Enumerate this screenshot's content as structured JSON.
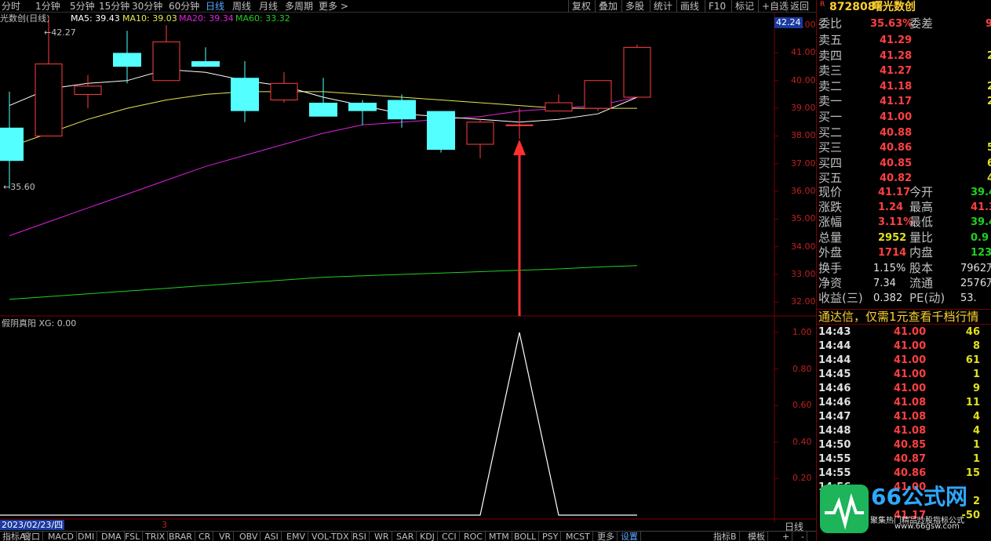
{
  "toolbar": {
    "periods": [
      "分时",
      "1分钟",
      "5分钟",
      "15分钟",
      "30分钟",
      "60分钟",
      "日线",
      "周线",
      "月线",
      "多周期",
      "更多 >"
    ],
    "active_period": "日线",
    "right_buttons": [
      "复权",
      "叠加",
      "多股",
      "统计",
      "画线",
      "F10",
      "标记",
      "+自选",
      "返回"
    ]
  },
  "legend": {
    "title": "光数创(日线)",
    "ma5": "MA5: 39.43",
    "ma10": "MA10: 39.03",
    "ma20": "MA20: 39.34",
    "ma60": "MA60: 33.32"
  },
  "colors": {
    "up": "#ff4040",
    "down": "#54ffff",
    "ma5": "#ffffff",
    "ma10": "#e8e850",
    "ma20": "#e020e0",
    "ma60": "#20d020",
    "grid": "#7a0000",
    "arrow": "#ff3030"
  },
  "main_chart": {
    "price_axis": [
      "42.00",
      "41.00",
      "40.00",
      "39.00",
      "38.00",
      "37.00",
      "36.00",
      "35.00",
      "34.00",
      "33.00",
      "32.00"
    ],
    "current_price_label": "42.24",
    "high_marker": "42.27",
    "low_marker": "35.60"
  },
  "indicator": {
    "title": "假阴真阳 XG: 0.00",
    "axis": [
      "1.00",
      "0.80",
      "0.60",
      "0.40",
      "0.20"
    ],
    "period_label": "日线"
  },
  "chart_data": {
    "type": "candlestick",
    "ohlc": [
      {
        "o": 38.3,
        "h": 39.6,
        "l": 36.1,
        "c": 37.1
      },
      {
        "o": 38.0,
        "h": 42.27,
        "l": 38.0,
        "c": 40.6
      },
      {
        "o": 39.5,
        "h": 40.2,
        "l": 39.0,
        "c": 39.8
      },
      {
        "o": 41.0,
        "h": 41.8,
        "l": 39.9,
        "c": 40.5
      },
      {
        "o": 40.0,
        "h": 42.0,
        "l": 40.0,
        "c": 41.4
      },
      {
        "o": 40.7,
        "h": 41.2,
        "l": 40.5,
        "c": 40.5
      },
      {
        "o": 40.1,
        "h": 40.7,
        "l": 38.5,
        "c": 38.9
      },
      {
        "o": 39.3,
        "h": 40.3,
        "l": 39.2,
        "c": 39.9
      },
      {
        "o": 39.2,
        "h": 40.1,
        "l": 38.8,
        "c": 38.7
      },
      {
        "o": 39.2,
        "h": 39.3,
        "l": 38.4,
        "c": 38.9
      },
      {
        "o": 39.3,
        "h": 39.5,
        "l": 38.3,
        "c": 38.6
      },
      {
        "o": 38.9,
        "h": 38.9,
        "l": 37.4,
        "c": 37.5
      },
      {
        "o": 37.7,
        "h": 38.6,
        "l": 37.2,
        "c": 38.5
      },
      {
        "o": 38.4,
        "h": 39.0,
        "l": 37.9,
        "c": 38.4
      },
      {
        "o": 38.9,
        "h": 39.5,
        "l": 38.9,
        "c": 39.2
      },
      {
        "o": 39.0,
        "h": 40.0,
        "l": 38.9,
        "c": 40.0
      },
      {
        "o": 39.4,
        "h": 41.3,
        "l": 39.4,
        "c": 41.2
      }
    ],
    "ma5": [
      39.1,
      39.7,
      39.9,
      40.0,
      40.4,
      40.3,
      40.0,
      39.8,
      39.4,
      39.1,
      38.8,
      38.7,
      38.6,
      38.5,
      38.6,
      38.8,
      39.4
    ],
    "ma10": [
      37.6,
      38.1,
      38.6,
      39.0,
      39.3,
      39.5,
      39.6,
      39.6,
      39.6,
      39.5,
      39.4,
      39.3,
      39.2,
      39.1,
      39.0,
      39.0,
      39.0
    ],
    "ma20": [
      34.4,
      34.9,
      35.4,
      35.9,
      36.4,
      36.9,
      37.3,
      37.7,
      38.1,
      38.4,
      38.5,
      38.6,
      38.7,
      38.9,
      39.0,
      39.1,
      39.4
    ],
    "ma60": [
      32.1,
      32.2,
      32.3,
      32.4,
      32.5,
      32.6,
      32.7,
      32.8,
      32.9,
      32.95,
      33.0,
      33.05,
      33.1,
      33.15,
      33.2,
      33.27,
      33.32
    ],
    "signal": [
      0,
      0,
      0,
      0,
      0,
      0,
      0,
      0,
      0,
      0,
      0,
      0,
      0,
      1,
      0,
      0,
      0
    ],
    "ylim": [
      31.5,
      42.4
    ]
  },
  "right_panel": {
    "code": "872808",
    "name": "曙光数创",
    "r_badge": "R",
    "weibi_label": "委比",
    "weibi": "35.63%",
    "weicha_label": "委差",
    "weicha": "9",
    "asks": [
      {
        "label": "卖五",
        "price": "41.29",
        "vol": ""
      },
      {
        "label": "卖四",
        "price": "41.28",
        "vol": "2"
      },
      {
        "label": "卖三",
        "price": "41.27",
        "vol": ""
      },
      {
        "label": "卖二",
        "price": "41.18",
        "vol": "2"
      },
      {
        "label": "卖一",
        "price": "41.17",
        "vol": "2"
      }
    ],
    "bids": [
      {
        "label": "买一",
        "price": "41.00",
        "vol": ""
      },
      {
        "label": "买二",
        "price": "40.88",
        "vol": ""
      },
      {
        "label": "买三",
        "price": "40.86",
        "vol": "5"
      },
      {
        "label": "买四",
        "price": "40.85",
        "vol": "6"
      },
      {
        "label": "买五",
        "price": "40.82",
        "vol": "4"
      }
    ],
    "stats": [
      {
        "l1": "现价",
        "v1": "41.17",
        "l2": "今开",
        "v2": "39.4",
        "c1": "red",
        "c2": "green"
      },
      {
        "l1": "涨跌",
        "v1": "1.24",
        "l2": "最高",
        "v2": "41.3",
        "c1": "red",
        "c2": "red"
      },
      {
        "l1": "涨幅",
        "v1": "3.11%",
        "l2": "最低",
        "v2": "39.4",
        "c1": "red",
        "c2": "green"
      },
      {
        "l1": "总量",
        "v1": "2952",
        "l2": "量比",
        "v2": "0.9",
        "c1": "yel",
        "c2": "green"
      },
      {
        "l1": "外盘",
        "v1": "1714",
        "l2": "内盘",
        "v2": "123",
        "c1": "red",
        "c2": "green"
      }
    ],
    "stats2": [
      {
        "l1": "换手",
        "v1": "1.15%",
        "l2": "股本",
        "v2": "7962万"
      },
      {
        "l1": "净资",
        "v1": "7.34",
        "l2": "流通",
        "v2": "2576万"
      },
      {
        "l1": "收益(三)",
        "v1": "0.382",
        "l2": "PE(动)",
        "v2": "53."
      }
    ],
    "ad": "通达信，仅需1元查看千档行情",
    "ticks": [
      {
        "t": "14:43",
        "p": "41.00",
        "v": "46",
        "vc": "yel"
      },
      {
        "t": "14:44",
        "p": "41.00",
        "v": "8",
        "vc": "yel"
      },
      {
        "t": "14:44",
        "p": "41.00",
        "v": "61",
        "vc": "yel"
      },
      {
        "t": "14:45",
        "p": "41.00",
        "v": "1",
        "vc": "yel"
      },
      {
        "t": "14:46",
        "p": "41.00",
        "v": "9",
        "vc": "yel"
      },
      {
        "t": "14:46",
        "p": "41.08",
        "v": "11",
        "vc": "yel"
      },
      {
        "t": "14:47",
        "p": "41.08",
        "v": "4",
        "vc": "yel"
      },
      {
        "t": "14:48",
        "p": "41.08",
        "v": "4",
        "vc": "yel"
      },
      {
        "t": "14:50",
        "p": "40.85",
        "v": "1",
        "vc": "yel"
      },
      {
        "t": "14:55",
        "p": "40.87",
        "v": "1",
        "vc": "yel"
      },
      {
        "t": "14:55",
        "p": "40.86",
        "v": "15",
        "vc": "yel"
      },
      {
        "t": "14:56",
        "p": "41.00",
        "v": "",
        "vc": "yel"
      },
      {
        "t": "",
        "p": "",
        "v": "2",
        "vc": "yel"
      },
      {
        "t": "",
        "p": "41.17",
        "v": "-50",
        "vc": "yel"
      }
    ]
  },
  "watermark": {
    "brand": "66公式网",
    "sub": "聚集热门精品炒股指标公式",
    "url": "www.66gsw.com"
  },
  "bottom": {
    "date": "2023/02/23/四",
    "marker": "3",
    "tabs": [
      "指标A",
      "窗口",
      "MACD",
      "DMI",
      "DMA",
      "FSL",
      "TRIX",
      "BRAR",
      "CR",
      "VR",
      "OBV",
      "ASI",
      "EMV",
      "VOL-TDX",
      "RSI",
      "WR",
      "SAR",
      "KDJ",
      "CCI",
      "ROC",
      "MTM",
      "BOLL",
      "PSY",
      "MCST",
      "更多",
      "设置"
    ],
    "right_tabs": [
      "指标B",
      "模板",
      "+",
      "-"
    ]
  }
}
